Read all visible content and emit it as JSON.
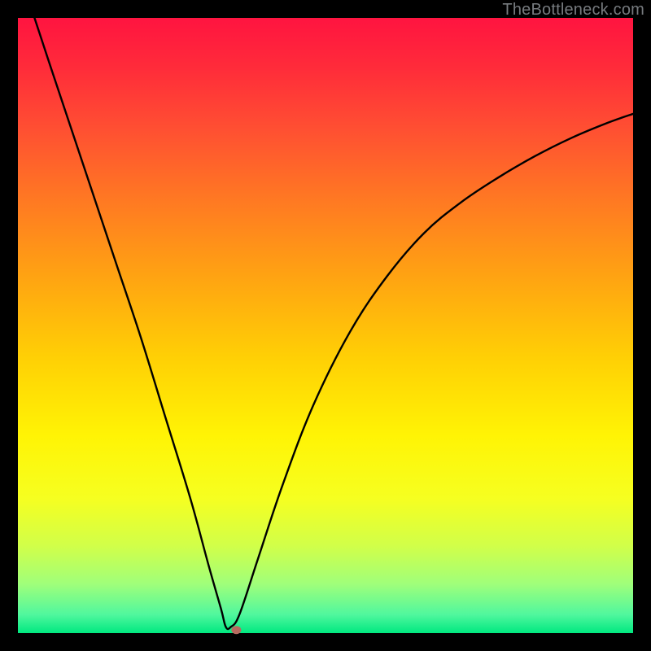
{
  "watermark": "TheBottleneck.com",
  "chart_data": {
    "type": "line",
    "title": "",
    "xlabel": "",
    "ylabel": "",
    "xlim": [
      0,
      1
    ],
    "ylim": [
      0,
      1
    ],
    "series": [
      {
        "name": "bottleneck-curve",
        "color": "#000000",
        "points": [
          {
            "x": 0.027,
            "y": 1.0
          },
          {
            "x": 0.05,
            "y": 0.93
          },
          {
            "x": 0.08,
            "y": 0.84
          },
          {
            "x": 0.12,
            "y": 0.72
          },
          {
            "x": 0.16,
            "y": 0.6
          },
          {
            "x": 0.2,
            "y": 0.48
          },
          {
            "x": 0.24,
            "y": 0.35
          },
          {
            "x": 0.28,
            "y": 0.22
          },
          {
            "x": 0.31,
            "y": 0.11
          },
          {
            "x": 0.33,
            "y": 0.04
          },
          {
            "x": 0.338,
            "y": 0.01
          },
          {
            "x": 0.346,
            "y": 0.01
          },
          {
            "x": 0.36,
            "y": 0.03
          },
          {
            "x": 0.39,
            "y": 0.12
          },
          {
            "x": 0.43,
            "y": 0.24
          },
          {
            "x": 0.48,
            "y": 0.37
          },
          {
            "x": 0.54,
            "y": 0.49
          },
          {
            "x": 0.6,
            "y": 0.58
          },
          {
            "x": 0.66,
            "y": 0.65
          },
          {
            "x": 0.72,
            "y": 0.7
          },
          {
            "x": 0.78,
            "y": 0.74
          },
          {
            "x": 0.84,
            "y": 0.775
          },
          {
            "x": 0.9,
            "y": 0.805
          },
          {
            "x": 0.96,
            "y": 0.83
          },
          {
            "x": 1.0,
            "y": 0.844
          }
        ]
      }
    ],
    "marker": {
      "x": 0.355,
      "y": 0.005,
      "color": "#b76a5f"
    },
    "background_gradient": {
      "stops": [
        {
          "offset": 0.0,
          "color": "#ff1440"
        },
        {
          "offset": 0.08,
          "color": "#ff2b3a"
        },
        {
          "offset": 0.18,
          "color": "#ff4f32"
        },
        {
          "offset": 0.3,
          "color": "#ff7a22"
        },
        {
          "offset": 0.42,
          "color": "#ffa312"
        },
        {
          "offset": 0.55,
          "color": "#ffcf05"
        },
        {
          "offset": 0.68,
          "color": "#fff405"
        },
        {
          "offset": 0.78,
          "color": "#f6ff20"
        },
        {
          "offset": 0.86,
          "color": "#d0ff4a"
        },
        {
          "offset": 0.92,
          "color": "#a0ff7a"
        },
        {
          "offset": 0.97,
          "color": "#50f79e"
        },
        {
          "offset": 1.0,
          "color": "#00e880"
        }
      ]
    },
    "frame": {
      "thickness_frac": 0.027,
      "color": "#000000"
    }
  }
}
